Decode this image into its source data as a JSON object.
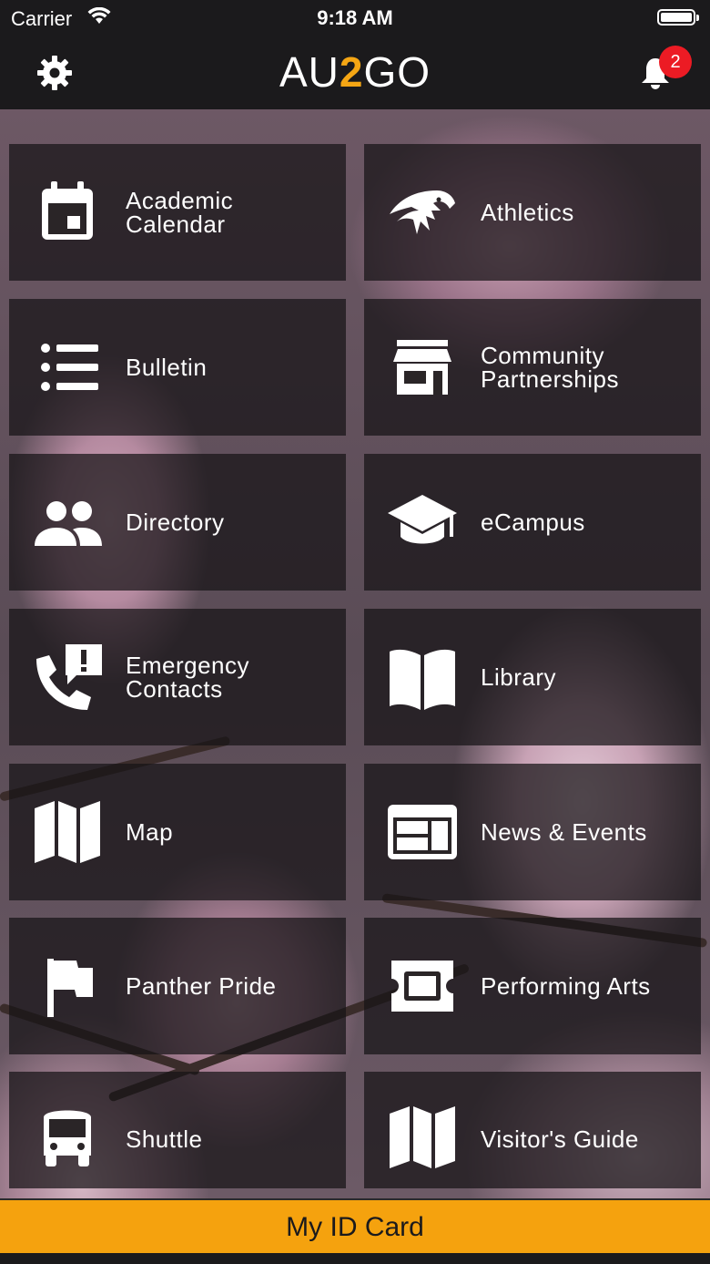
{
  "status_bar": {
    "carrier": "Carrier",
    "time": "9:18 AM"
  },
  "header": {
    "logo_prefix": "AU",
    "logo_middle": "2",
    "logo_suffix": "GO",
    "notification_count": "2",
    "accent_color": "#f5a614",
    "badge_color": "#ec1b24"
  },
  "tiles": [
    {
      "label": "Academic\nCalendar",
      "icon": "calendar-icon"
    },
    {
      "label": "Athletics",
      "icon": "panther-icon"
    },
    {
      "label": "Bulletin",
      "icon": "list-icon"
    },
    {
      "label": "Community\nPartnerships",
      "icon": "storefront-icon"
    },
    {
      "label": "Directory",
      "icon": "people-icon"
    },
    {
      "label": "eCampus",
      "icon": "graduation-cap-icon"
    },
    {
      "label": "Emergency\nContacts",
      "icon": "phone-alert-icon"
    },
    {
      "label": "Library",
      "icon": "book-icon"
    },
    {
      "label": "Map",
      "icon": "map-icon"
    },
    {
      "label": "News & Events",
      "icon": "news-icon"
    },
    {
      "label": "Panther Pride",
      "icon": "flag-icon"
    },
    {
      "label": "Performing Arts",
      "icon": "ticket-icon"
    },
    {
      "label": "Shuttle",
      "icon": "bus-icon"
    },
    {
      "label": "Visitor's Guide",
      "icon": "map-icon"
    }
  ],
  "footer": {
    "id_card_label": "My ID Card",
    "button_color": "#f5a20e"
  }
}
